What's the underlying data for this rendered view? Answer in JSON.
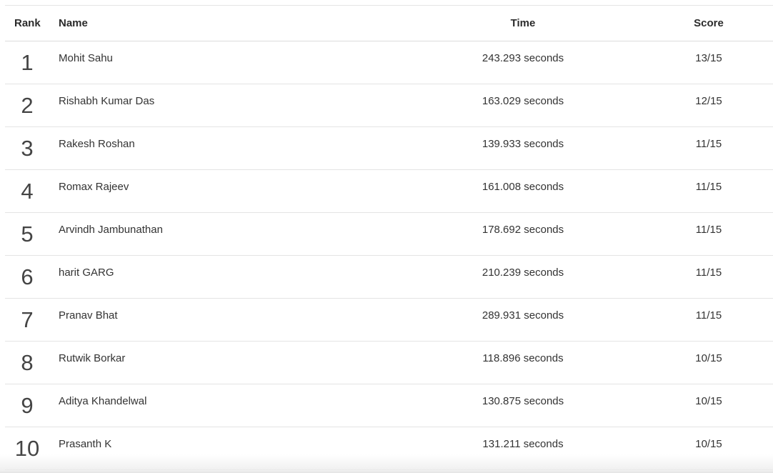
{
  "table": {
    "headers": {
      "rank": "Rank",
      "name": "Name",
      "time": "Time",
      "score": "Score"
    },
    "rows": [
      {
        "rank": "1",
        "name": "Mohit Sahu",
        "time": "243.293 seconds",
        "score": "13/15"
      },
      {
        "rank": "2",
        "name": "Rishabh Kumar Das",
        "time": "163.029 seconds",
        "score": "12/15"
      },
      {
        "rank": "3",
        "name": "Rakesh Roshan",
        "time": "139.933 seconds",
        "score": "11/15"
      },
      {
        "rank": "4",
        "name": "Romax Rajeev",
        "time": "161.008 seconds",
        "score": "11/15"
      },
      {
        "rank": "5",
        "name": "Arvindh Jambunathan",
        "time": "178.692 seconds",
        "score": "11/15"
      },
      {
        "rank": "6",
        "name": "harit GARG",
        "time": "210.239 seconds",
        "score": "11/15"
      },
      {
        "rank": "7",
        "name": "Pranav Bhat",
        "time": "289.931 seconds",
        "score": "11/15"
      },
      {
        "rank": "8",
        "name": "Rutwik Borkar",
        "time": "118.896 seconds",
        "score": "10/15"
      },
      {
        "rank": "9",
        "name": "Aditya Khandelwal",
        "time": "130.875 seconds",
        "score": "10/15"
      },
      {
        "rank": "10",
        "name": "Prasanth K",
        "time": "131.211 seconds",
        "score": "10/15"
      }
    ]
  }
}
